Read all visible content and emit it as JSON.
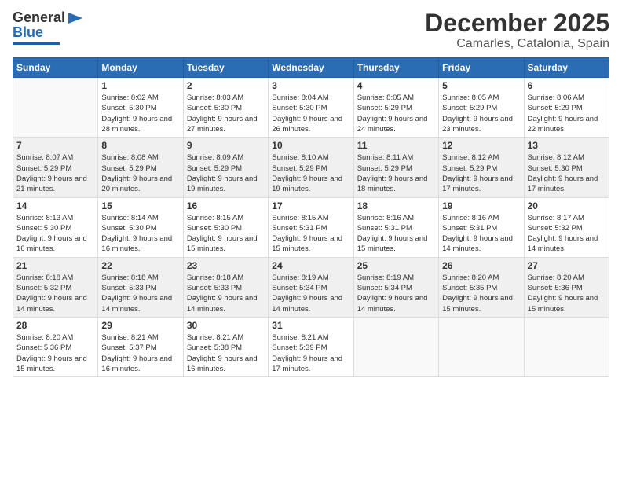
{
  "logo": {
    "line1": "General",
    "line2": "Blue"
  },
  "header": {
    "month": "December 2025",
    "location": "Camarles, Catalonia, Spain"
  },
  "weekdays": [
    "Sunday",
    "Monday",
    "Tuesday",
    "Wednesday",
    "Thursday",
    "Friday",
    "Saturday"
  ],
  "weeks": [
    [
      {
        "day": "",
        "sunrise": "",
        "sunset": "",
        "daylight": ""
      },
      {
        "day": "1",
        "sunrise": "Sunrise: 8:02 AM",
        "sunset": "Sunset: 5:30 PM",
        "daylight": "Daylight: 9 hours and 28 minutes."
      },
      {
        "day": "2",
        "sunrise": "Sunrise: 8:03 AM",
        "sunset": "Sunset: 5:30 PM",
        "daylight": "Daylight: 9 hours and 27 minutes."
      },
      {
        "day": "3",
        "sunrise": "Sunrise: 8:04 AM",
        "sunset": "Sunset: 5:30 PM",
        "daylight": "Daylight: 9 hours and 26 minutes."
      },
      {
        "day": "4",
        "sunrise": "Sunrise: 8:05 AM",
        "sunset": "Sunset: 5:29 PM",
        "daylight": "Daylight: 9 hours and 24 minutes."
      },
      {
        "day": "5",
        "sunrise": "Sunrise: 8:05 AM",
        "sunset": "Sunset: 5:29 PM",
        "daylight": "Daylight: 9 hours and 23 minutes."
      },
      {
        "day": "6",
        "sunrise": "Sunrise: 8:06 AM",
        "sunset": "Sunset: 5:29 PM",
        "daylight": "Daylight: 9 hours and 22 minutes."
      }
    ],
    [
      {
        "day": "7",
        "sunrise": "Sunrise: 8:07 AM",
        "sunset": "Sunset: 5:29 PM",
        "daylight": "Daylight: 9 hours and 21 minutes."
      },
      {
        "day": "8",
        "sunrise": "Sunrise: 8:08 AM",
        "sunset": "Sunset: 5:29 PM",
        "daylight": "Daylight: 9 hours and 20 minutes."
      },
      {
        "day": "9",
        "sunrise": "Sunrise: 8:09 AM",
        "sunset": "Sunset: 5:29 PM",
        "daylight": "Daylight: 9 hours and 19 minutes."
      },
      {
        "day": "10",
        "sunrise": "Sunrise: 8:10 AM",
        "sunset": "Sunset: 5:29 PM",
        "daylight": "Daylight: 9 hours and 19 minutes."
      },
      {
        "day": "11",
        "sunrise": "Sunrise: 8:11 AM",
        "sunset": "Sunset: 5:29 PM",
        "daylight": "Daylight: 9 hours and 18 minutes."
      },
      {
        "day": "12",
        "sunrise": "Sunrise: 8:12 AM",
        "sunset": "Sunset: 5:29 PM",
        "daylight": "Daylight: 9 hours and 17 minutes."
      },
      {
        "day": "13",
        "sunrise": "Sunrise: 8:12 AM",
        "sunset": "Sunset: 5:30 PM",
        "daylight": "Daylight: 9 hours and 17 minutes."
      }
    ],
    [
      {
        "day": "14",
        "sunrise": "Sunrise: 8:13 AM",
        "sunset": "Sunset: 5:30 PM",
        "daylight": "Daylight: 9 hours and 16 minutes."
      },
      {
        "day": "15",
        "sunrise": "Sunrise: 8:14 AM",
        "sunset": "Sunset: 5:30 PM",
        "daylight": "Daylight: 9 hours and 16 minutes."
      },
      {
        "day": "16",
        "sunrise": "Sunrise: 8:15 AM",
        "sunset": "Sunset: 5:30 PM",
        "daylight": "Daylight: 9 hours and 15 minutes."
      },
      {
        "day": "17",
        "sunrise": "Sunrise: 8:15 AM",
        "sunset": "Sunset: 5:31 PM",
        "daylight": "Daylight: 9 hours and 15 minutes."
      },
      {
        "day": "18",
        "sunrise": "Sunrise: 8:16 AM",
        "sunset": "Sunset: 5:31 PM",
        "daylight": "Daylight: 9 hours and 15 minutes."
      },
      {
        "day": "19",
        "sunrise": "Sunrise: 8:16 AM",
        "sunset": "Sunset: 5:31 PM",
        "daylight": "Daylight: 9 hours and 14 minutes."
      },
      {
        "day": "20",
        "sunrise": "Sunrise: 8:17 AM",
        "sunset": "Sunset: 5:32 PM",
        "daylight": "Daylight: 9 hours and 14 minutes."
      }
    ],
    [
      {
        "day": "21",
        "sunrise": "Sunrise: 8:18 AM",
        "sunset": "Sunset: 5:32 PM",
        "daylight": "Daylight: 9 hours and 14 minutes."
      },
      {
        "day": "22",
        "sunrise": "Sunrise: 8:18 AM",
        "sunset": "Sunset: 5:33 PM",
        "daylight": "Daylight: 9 hours and 14 minutes."
      },
      {
        "day": "23",
        "sunrise": "Sunrise: 8:18 AM",
        "sunset": "Sunset: 5:33 PM",
        "daylight": "Daylight: 9 hours and 14 minutes."
      },
      {
        "day": "24",
        "sunrise": "Sunrise: 8:19 AM",
        "sunset": "Sunset: 5:34 PM",
        "daylight": "Daylight: 9 hours and 14 minutes."
      },
      {
        "day": "25",
        "sunrise": "Sunrise: 8:19 AM",
        "sunset": "Sunset: 5:34 PM",
        "daylight": "Daylight: 9 hours and 14 minutes."
      },
      {
        "day": "26",
        "sunrise": "Sunrise: 8:20 AM",
        "sunset": "Sunset: 5:35 PM",
        "daylight": "Daylight: 9 hours and 15 minutes."
      },
      {
        "day": "27",
        "sunrise": "Sunrise: 8:20 AM",
        "sunset": "Sunset: 5:36 PM",
        "daylight": "Daylight: 9 hours and 15 minutes."
      }
    ],
    [
      {
        "day": "28",
        "sunrise": "Sunrise: 8:20 AM",
        "sunset": "Sunset: 5:36 PM",
        "daylight": "Daylight: 9 hours and 15 minutes."
      },
      {
        "day": "29",
        "sunrise": "Sunrise: 8:21 AM",
        "sunset": "Sunset: 5:37 PM",
        "daylight": "Daylight: 9 hours and 16 minutes."
      },
      {
        "day": "30",
        "sunrise": "Sunrise: 8:21 AM",
        "sunset": "Sunset: 5:38 PM",
        "daylight": "Daylight: 9 hours and 16 minutes."
      },
      {
        "day": "31",
        "sunrise": "Sunrise: 8:21 AM",
        "sunset": "Sunset: 5:39 PM",
        "daylight": "Daylight: 9 hours and 17 minutes."
      },
      {
        "day": "",
        "sunrise": "",
        "sunset": "",
        "daylight": ""
      },
      {
        "day": "",
        "sunrise": "",
        "sunset": "",
        "daylight": ""
      },
      {
        "day": "",
        "sunrise": "",
        "sunset": "",
        "daylight": ""
      }
    ]
  ]
}
